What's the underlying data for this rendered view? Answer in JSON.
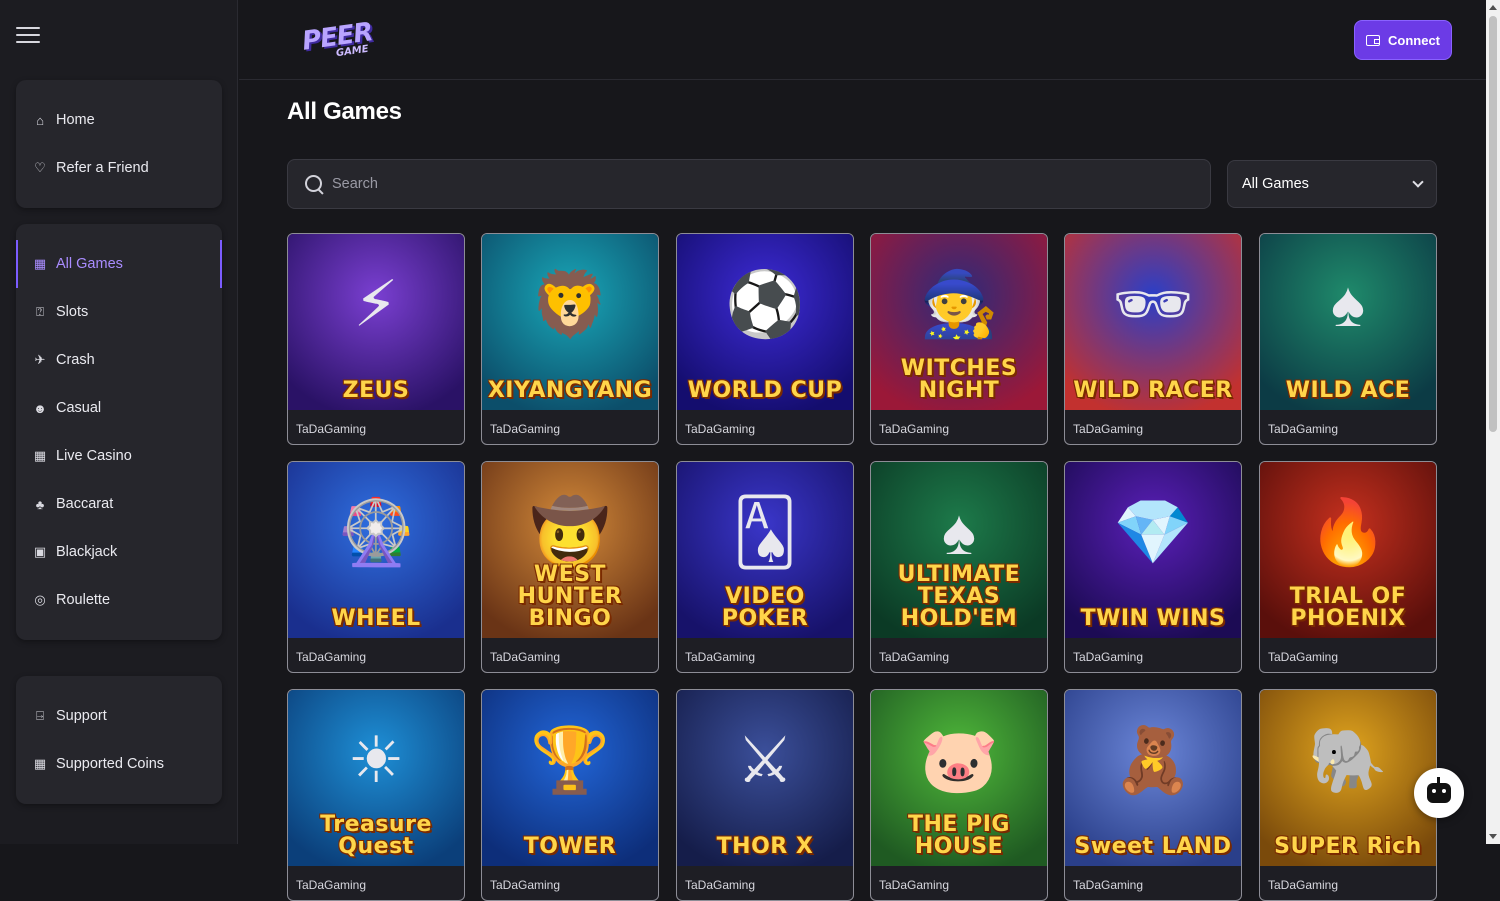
{
  "brand": {
    "logo_main": "PEER",
    "logo_sub": "GAME"
  },
  "header": {
    "connect_label": "Connect"
  },
  "sidebar": {
    "group_main": [
      {
        "label": "Home",
        "icon": "home-icon",
        "glyph": "⌂"
      },
      {
        "label": "Refer a Friend",
        "icon": "gift-heart-icon",
        "glyph": "♡"
      }
    ],
    "group_games": [
      {
        "label": "All Games",
        "icon": "grid-icon",
        "glyph": "▦",
        "active": true
      },
      {
        "label": "Slots",
        "icon": "slot-machine-icon",
        "glyph": "⍰"
      },
      {
        "label": "Crash",
        "icon": "plane-icon",
        "glyph": "✈"
      },
      {
        "label": "Casual",
        "icon": "casual-icon",
        "glyph": "☻"
      },
      {
        "label": "Live Casino",
        "icon": "live-casino-icon",
        "glyph": "▦"
      },
      {
        "label": "Baccarat",
        "icon": "cards-icon",
        "glyph": "♣"
      },
      {
        "label": "Blackjack",
        "icon": "blackjack-icon",
        "glyph": "▣"
      },
      {
        "label": "Roulette",
        "icon": "roulette-icon",
        "glyph": "◎"
      }
    ],
    "group_help": [
      {
        "label": "Support",
        "icon": "support-icon",
        "glyph": "⍈"
      },
      {
        "label": "Supported Coins",
        "icon": "coins-icon",
        "glyph": "▦"
      }
    ]
  },
  "main": {
    "title": "All Games",
    "search_placeholder": "Search",
    "filter_selected": "All Games"
  },
  "games": [
    {
      "art_text": "ZEUS",
      "glyph": "⚡",
      "provider": "TaDaGaming",
      "bg": "#7a3fd1",
      "bg2": "#2a1266"
    },
    {
      "art_text": "XIYANGYANG",
      "glyph": "🦁",
      "provider": "TaDaGaming",
      "bg": "#19a7b8",
      "bg2": "#0c4e6a"
    },
    {
      "art_text": "WORLD CUP",
      "glyph": "⚽",
      "provider": "TaDaGaming",
      "bg": "#3d2bd6",
      "bg2": "#140d6e"
    },
    {
      "art_text": "WITCHES NIGHT",
      "glyph": "🧙",
      "provider": "TaDaGaming",
      "bg": "#2e2a7a",
      "bg2": "#9b1838"
    },
    {
      "art_text": "WILD RACER",
      "glyph": "🕶",
      "provider": "TaDaGaming",
      "bg": "#2b3fc7",
      "bg2": "#c2312f"
    },
    {
      "art_text": "WILD ACE",
      "glyph": "♠",
      "provider": "TaDaGaming",
      "bg": "#1f8a6b",
      "bg2": "#0c3b45"
    },
    {
      "art_text": "WHEEL",
      "glyph": "🎡",
      "provider": "TaDaGaming",
      "bg": "#2f6fe0",
      "bg2": "#1a2f8e"
    },
    {
      "art_text": "WEST HUNTER BINGO",
      "glyph": "🤠",
      "provider": "TaDaGaming",
      "bg": "#d38a3a",
      "bg2": "#6a3416"
    },
    {
      "art_text": "VIDEO POKER",
      "glyph": "🂡",
      "provider": "TaDaGaming",
      "bg": "#3a36c9",
      "bg2": "#17126a"
    },
    {
      "art_text": "ULTIMATE TEXAS HOLD'EM",
      "glyph": "♠",
      "provider": "TaDaGaming",
      "bg": "#1d7a4a",
      "bg2": "#0b3a25"
    },
    {
      "art_text": "TWIN WINS",
      "glyph": "💎",
      "provider": "TaDaGaming",
      "bg": "#5a1fb8",
      "bg2": "#1c0b54"
    },
    {
      "art_text": "TRIAL OF PHOENIX",
      "glyph": "🔥",
      "provider": "TaDaGaming",
      "bg": "#c5301e",
      "bg2": "#5a0f0b"
    },
    {
      "art_text": "Treasure Quest",
      "glyph": "☀",
      "provider": "TaDaGaming",
      "bg": "#1e8fd6",
      "bg2": "#0b3f7a"
    },
    {
      "art_text": "TOWER",
      "glyph": "🏆",
      "provider": "TaDaGaming",
      "bg": "#2266d8",
      "bg2": "#0d2e7a"
    },
    {
      "art_text": "THOR X",
      "glyph": "⚔",
      "provider": "TaDaGaming",
      "bg": "#3b4f9a",
      "bg2": "#151d4a"
    },
    {
      "art_text": "THE PIG HOUSE",
      "glyph": "🐷",
      "provider": "TaDaGaming",
      "bg": "#4fb83a",
      "bg2": "#1f5a22"
    },
    {
      "art_text": "Sweet LAND",
      "glyph": "🧸",
      "provider": "TaDaGaming",
      "bg": "#6b86d8",
      "bg2": "#2a3f8a"
    },
    {
      "art_text": "SUPER Rich",
      "glyph": "🐘",
      "provider": "TaDaGaming",
      "bg": "#e0a41e",
      "bg2": "#7a4a0b"
    }
  ]
}
